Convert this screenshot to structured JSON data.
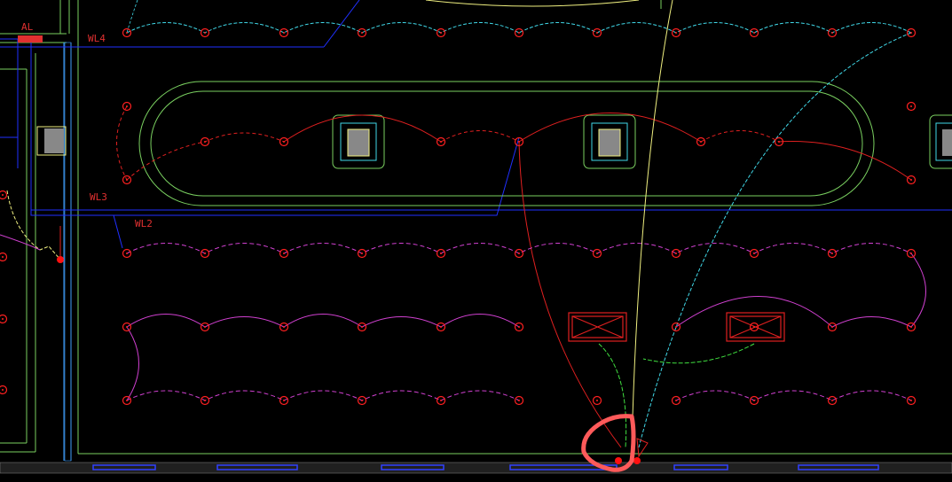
{
  "labels": {
    "panel": "AL",
    "circuit_wl4": "WL4",
    "circuit_wl3": "WL3",
    "circuit_wl2": "WL2"
  },
  "colors": {
    "background": "#000000",
    "fixture": "#ff2020",
    "wall_blue": "#2030ff",
    "wall_green": "#7ad060",
    "cyan": "#40d8e8",
    "magenta": "#d040d0",
    "red": "#e02020",
    "yellow": "#f0f080",
    "highlight": "#ff5a5a"
  },
  "icons": [
    "ceiling-light-fixture-icon",
    "column-icon",
    "exhaust-fan-icon",
    "distribution-panel-icon",
    "markup-highlight-icon"
  ]
}
